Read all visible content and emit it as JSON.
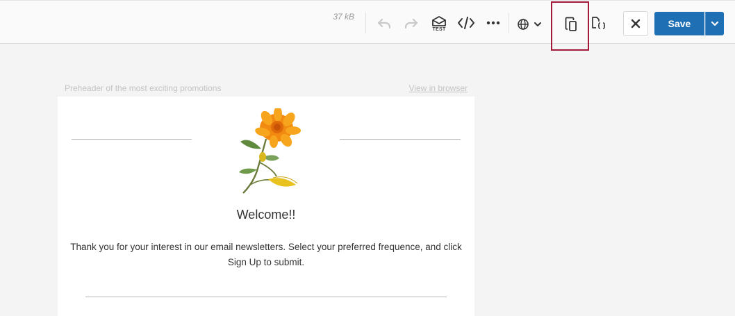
{
  "toolbar": {
    "size": "37 kB",
    "test_label": "TEST",
    "icons": {
      "undo": "undo-icon",
      "redo": "redo-icon",
      "test": "test-email-icon",
      "code": "code-icon",
      "more": "more-icon",
      "language": "globe-icon",
      "mobile": "mobile-view-icon",
      "amp": "amp-code-icon",
      "close": "close-icon"
    },
    "save_label": "Save"
  },
  "email": {
    "preheader": "Preheader of the most exciting promotions",
    "view_in_browser": "View in browser",
    "welcome": "Welcome!!",
    "body": "Thank you for your interest in our email newsletters. Select your preferred frequence, and click Sign Up to submit."
  },
  "colors": {
    "accent": "#1f6fb5",
    "highlight": "#a3193a",
    "flower": "#f28a12"
  }
}
